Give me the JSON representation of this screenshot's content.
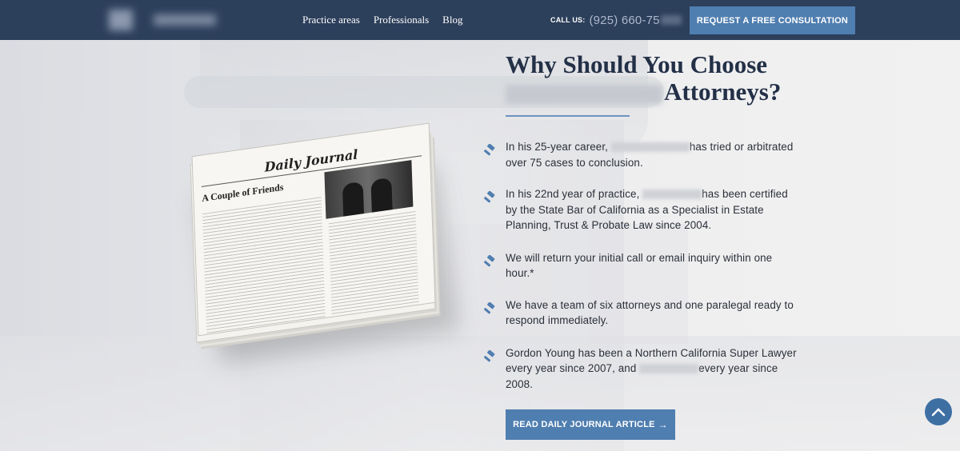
{
  "nav": {
    "menu": [
      "Practice areas",
      "Professionals",
      "Blog"
    ],
    "call_label": "CALL US:",
    "phone_visible": "(925) 660-75",
    "cta": "REQUEST A FREE CONSULTATION"
  },
  "newspaper": {
    "masthead": "Daily Journal",
    "headline": "A Couple of Friends"
  },
  "main": {
    "title_line1": "Why Should You Choose",
    "title_line2_end": "Attorneys?",
    "points": [
      {
        "a": "In his 25-year career, ",
        "b": "has tried or arbitrated over 75 cases to conclusion."
      },
      {
        "a": "In his 22nd year of practice, ",
        "b": "has been certified by the State Bar of California as a Specialist in Estate Planning, Trust & Probate Law since 2004."
      },
      {
        "a": "We will return your initial call or email inquiry within one hour.*"
      },
      {
        "a": "We have a team of six attorneys and one paralegal ready to respond immediately."
      },
      {
        "a": "Gordon Young has been a Northern California Super Lawyer every year since 2007, and ",
        "b": "every year since 2008."
      }
    ],
    "cta": "READ DAILY JOURNAL ARTICLE",
    "cta_arrow": "→"
  },
  "colors": {
    "nav_bg": "#2c3f5b",
    "accent": "#4f7eb0",
    "heading": "#233047"
  },
  "icons": {
    "point_icon": "gavel-icon",
    "scroll_icon": "chevron-up-icon"
  }
}
